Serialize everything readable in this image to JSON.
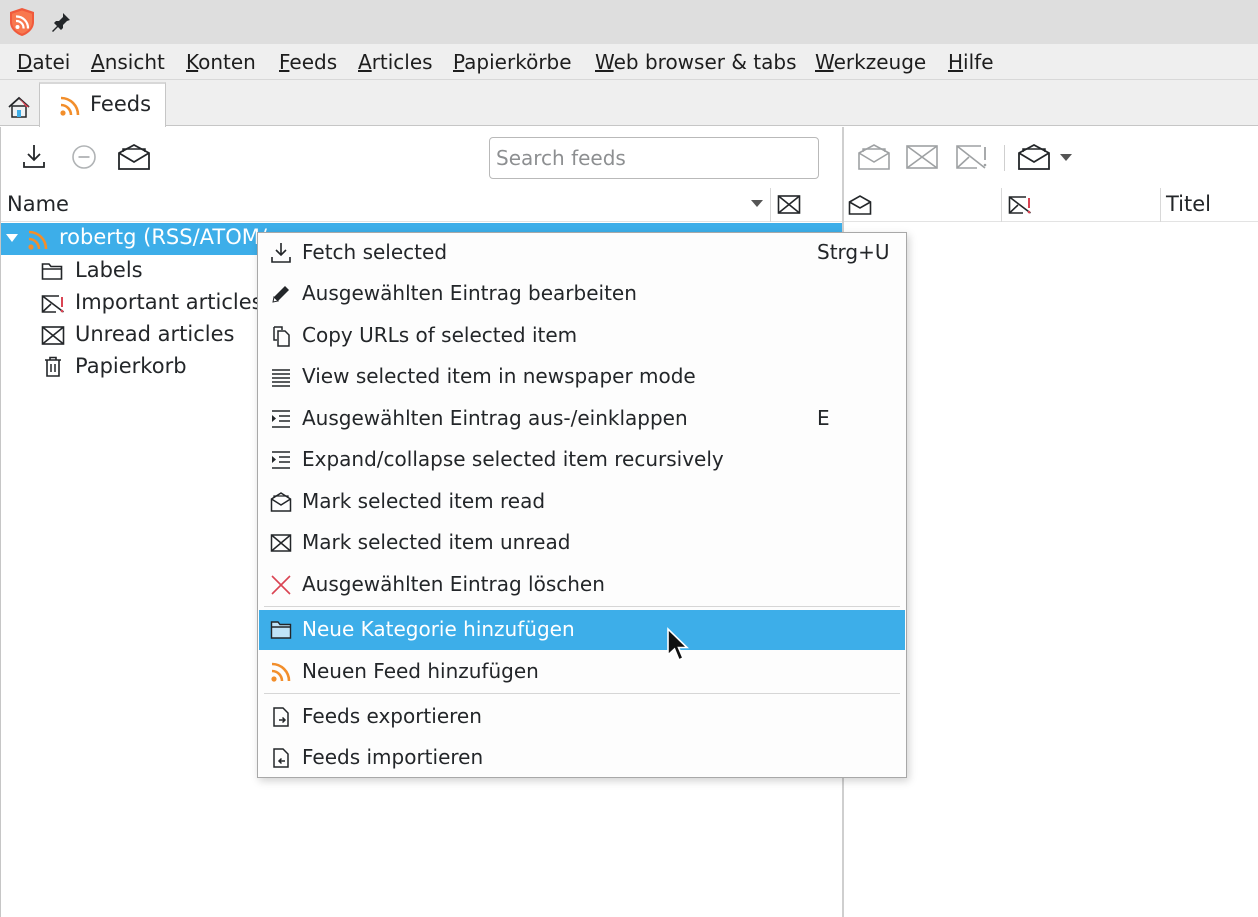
{
  "menubar": {
    "items": [
      "Datei",
      "Ansicht",
      "Konten",
      "Feeds",
      "Articles",
      "Papierkörbe",
      "Web browser & tabs",
      "Werkzeuge",
      "Hilfe"
    ]
  },
  "tabs": {
    "feeds_label": "Feeds"
  },
  "feeds_pane": {
    "search_placeholder": "Search feeds",
    "column_name": "Name",
    "tree": {
      "root": "robertg (RSS/ATOM/",
      "children": [
        "Labels",
        "Important articles",
        "Unread articles",
        "Papierkorb"
      ]
    }
  },
  "articles_pane": {
    "column_title": "Titel"
  },
  "context_menu": {
    "items": [
      {
        "label": "Fetch selected",
        "shortcut": "Strg+U",
        "icon": "download-icon"
      },
      {
        "label": "Ausgewählten Eintrag bearbeiten",
        "shortcut": "",
        "icon": "pencil-icon"
      },
      {
        "label": "Copy URLs of selected item",
        "shortcut": "",
        "icon": "copy-icon"
      },
      {
        "label": "View selected item in newspaper mode",
        "shortcut": "",
        "icon": "newspaper-icon"
      },
      {
        "label": "Ausgewählten Eintrag aus-/einklappen",
        "shortcut": "E",
        "icon": "collapse-icon"
      },
      {
        "label": "Expand/collapse selected item recursively",
        "shortcut": "",
        "icon": "collapse-recursive-icon"
      },
      {
        "label": "Mark selected item read",
        "shortcut": "",
        "icon": "envelope-open-icon"
      },
      {
        "label": "Mark selected item unread",
        "shortcut": "",
        "icon": "envelope-closed-icon"
      },
      {
        "label": "Ausgewählten Eintrag löschen",
        "shortcut": "",
        "icon": "delete-cross-icon"
      },
      {
        "label": "Neue Kategorie hinzufügen",
        "shortcut": "",
        "icon": "folder-icon",
        "highlighted": true
      },
      {
        "label": "Neuen Feed hinzufügen",
        "shortcut": "",
        "icon": "rss-icon"
      },
      {
        "label": "Feeds exportieren",
        "shortcut": "",
        "icon": "export-icon"
      },
      {
        "label": "Feeds importieren",
        "shortcut": "",
        "icon": "import-icon"
      }
    ]
  },
  "colors": {
    "selection": "#3daee9",
    "rss": "#f28e2b",
    "danger": "#da4453"
  }
}
